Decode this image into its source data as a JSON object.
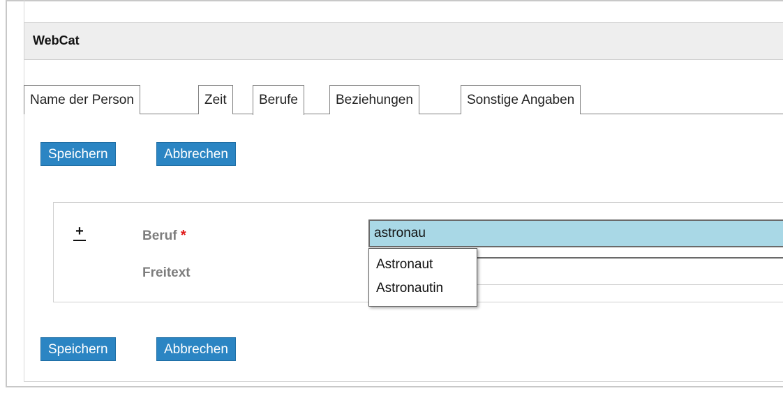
{
  "app": {
    "title": "WebCat"
  },
  "tabs": [
    {
      "label": "Name der Person",
      "active": false
    },
    {
      "label": "Zeit",
      "active": false
    },
    {
      "label": "Berufe",
      "active": true
    },
    {
      "label": "Beziehungen",
      "active": false
    },
    {
      "label": "Sonstige Angaben",
      "active": false
    }
  ],
  "actions": {
    "save_label": "Speichern",
    "cancel_label": "Abbrechen"
  },
  "form": {
    "expand_symbol": "+",
    "beruf": {
      "label": "Beruf",
      "required_marker": "*",
      "value": "astronau"
    },
    "freitext": {
      "label": "Freitext",
      "value": ""
    }
  },
  "autocomplete": {
    "options": [
      "Astronaut",
      "Astronautin"
    ]
  },
  "colors": {
    "button": "#2b85c3",
    "input_highlight": "#a9d8e6",
    "required": "#e01a1a"
  }
}
